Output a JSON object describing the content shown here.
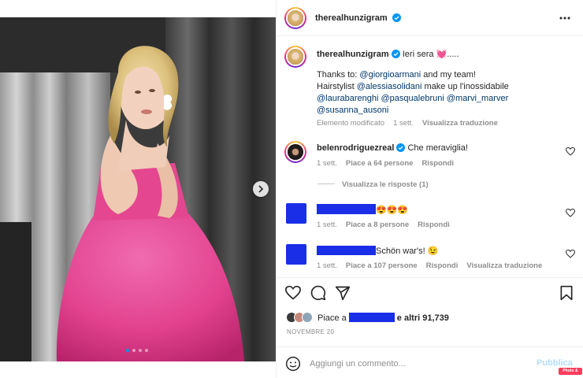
{
  "post": {
    "author": "therealhunzigram",
    "carousel_dots": 4,
    "active_dot": 0
  },
  "caption": {
    "author": "therealhunzigram",
    "first_line": "Ieri sera 💓.....",
    "thanks_prefix": "Thanks to: ",
    "thanks_mention": "@giorgioarmani",
    "thanks_suffix": " and my team!",
    "hair_prefix": "Hairstylist ",
    "hair_mention": "@alessiasolidani",
    "makeup_text": " make up l'inossidabile",
    "mention_3": "@laurabarenghi",
    "mention_4": "@pasqualebruni",
    "mention_5": "@marvi_marver",
    "mention_6": "@susanna_ausoni",
    "edited": "Elemento modificato",
    "time": "1 sett.",
    "translate": "Visualizza traduzione"
  },
  "comments": [
    {
      "author": "belenrodriguezreal",
      "text": "Che meraviglia!",
      "time": "1 sett.",
      "likes": "Piace a 64 persone",
      "reply": "Rispondi",
      "view_replies": "Visualizza le risposte (1)"
    },
    {
      "text": "😍😍😍",
      "time": "1 sett.",
      "likes": "Piace a 8 persone",
      "reply": "Rispondi"
    },
    {
      "text": "Schön war's! 😉",
      "time": "1 sett.",
      "likes": "Piace a 107 persone",
      "reply": "Rispondi",
      "translate": "Visualizza traduzione"
    }
  ],
  "likes": {
    "prefix": "Piace a ",
    "suffix": " e altri 91,739"
  },
  "date": "NOVEMBRE 20",
  "composer": {
    "placeholder": "Aggiungi un commento...",
    "publish": "Pubblica"
  },
  "badge": "Photo & Video",
  "colors": {
    "accent": "#0095f6",
    "mention": "#00376b",
    "redaction": "#1a2ee8",
    "dress": "#e8449a"
  }
}
